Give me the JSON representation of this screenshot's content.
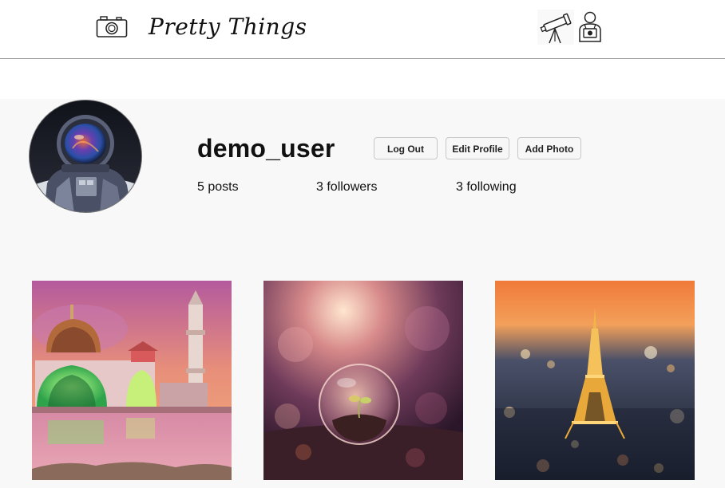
{
  "header": {
    "brand": "Pretty Things",
    "logo_icon": "camera-icon",
    "nav_icons": [
      "telescope-icon",
      "photographer-icon"
    ]
  },
  "profile": {
    "username": "demo_user",
    "buttons": {
      "logout": "Log Out",
      "edit_profile": "Edit Profile",
      "add_photo": "Add Photo"
    },
    "stats": {
      "posts": "5 posts",
      "followers": "3 followers",
      "following": "3 following"
    },
    "avatar_icon": "astronaut-avatar"
  },
  "photos": [
    {
      "subject": "mosque-at-sunset"
    },
    {
      "subject": "glass-sphere-with-sprout"
    },
    {
      "subject": "eiffel-tower-at-night"
    }
  ],
  "colors": {
    "header_bg": "#ffffff",
    "content_bg": "#f8f8f8",
    "button_border": "#c8c8c8",
    "divider": "#9a9a9a"
  }
}
